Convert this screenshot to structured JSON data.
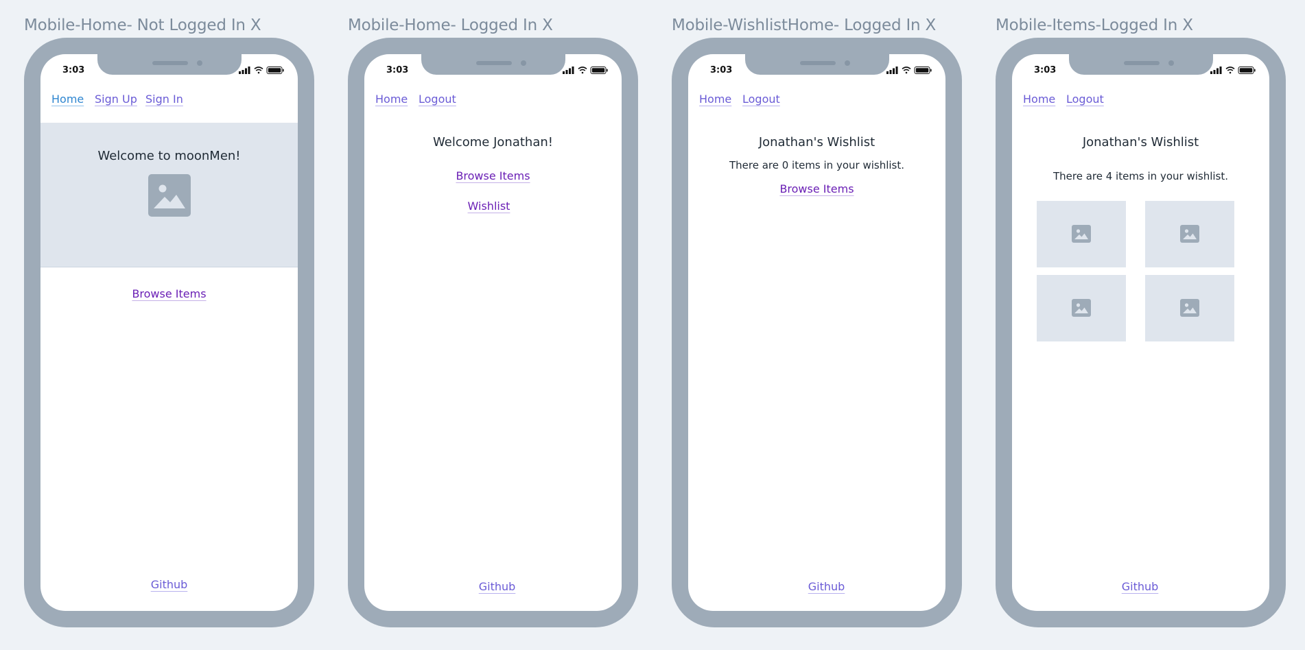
{
  "frames": [
    {
      "title": "Mobile-Home- Not Logged In X",
      "time": "3:03",
      "nav": [
        "Home",
        "Sign Up",
        "Sign In"
      ],
      "hero_title": "Welcome to moonMen!",
      "browse_label": "Browse Items",
      "github_label": "Github"
    },
    {
      "title": "Mobile-Home- Logged In X",
      "time": "3:03",
      "nav": [
        "Home",
        "Logout"
      ],
      "heading": "Welcome Jonathan!",
      "browse_label": "Browse Items",
      "wishlist_label": "Wishlist",
      "github_label": "Github"
    },
    {
      "title": "Mobile-WishlistHome- Logged In X",
      "time": "3:03",
      "nav": [
        "Home",
        "Logout"
      ],
      "heading": "Jonathan's Wishlist",
      "subtext": "There are 0 items in your wishlist.",
      "browse_label": "Browse Items",
      "github_label": "Github"
    },
    {
      "title": "Mobile-Items-Logged In X",
      "time": "3:03",
      "nav": [
        "Home",
        "Logout"
      ],
      "heading": "Jonathan's Wishlist",
      "subtext": "There are 4 items in your wishlist.",
      "github_label": "Github"
    }
  ],
  "icons": {
    "image_placeholder": "image-icon",
    "signal": "cellular-signal-icon",
    "wifi": "wifi-icon",
    "battery": "battery-icon"
  },
  "colors": {
    "background": "#eef2f6",
    "phone_frame": "#9eabb8",
    "link_active": "#2f86d0",
    "link": "#6a5bd6",
    "link_visited": "#6a1fb5",
    "placeholder_fill": "#dfe5ed"
  }
}
